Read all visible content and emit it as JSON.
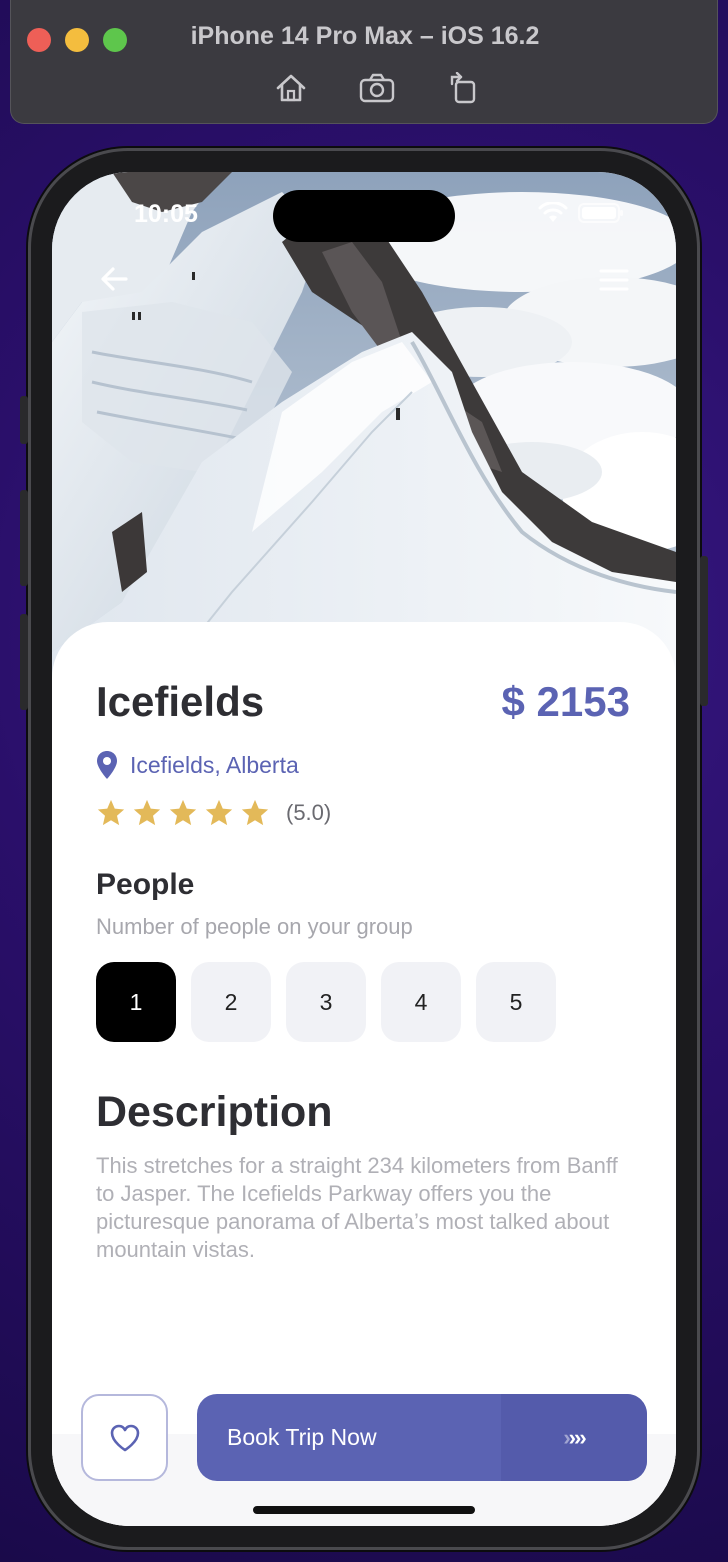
{
  "simulator": {
    "title": "iPhone 14 Pro Max – iOS 16.2",
    "tools": [
      "home-icon",
      "screenshot-icon",
      "rotate-icon"
    ]
  },
  "status_bar": {
    "time": "10:05",
    "icons": [
      "wifi-icon",
      "battery-icon"
    ]
  },
  "header": {
    "back_icon": "arrow-left-icon",
    "menu_icon": "menu-icon"
  },
  "trip": {
    "title": "Icefields",
    "price": "$ 2153",
    "location": "Icefields, Alberta",
    "rating_stars": 5,
    "rating_text": "(5.0)"
  },
  "people": {
    "heading": "People",
    "subtitle": "Number of people on your group",
    "options": [
      "1",
      "2",
      "3",
      "4",
      "5"
    ],
    "selected": "1"
  },
  "description": {
    "heading": "Description",
    "text": "This stretches for a straight 234 kilometers from Banff to Jasper. The Icefields Parkway offers you the picturesque panorama of Alberta’s most talked about mountain vistas."
  },
  "actions": {
    "favorite_icon": "heart-icon",
    "book_label": "Book Trip Now",
    "book_arrows": "›››"
  },
  "colors": {
    "accent": "#5b63b3",
    "star": "#e3b959",
    "title": "#2e2e33"
  }
}
